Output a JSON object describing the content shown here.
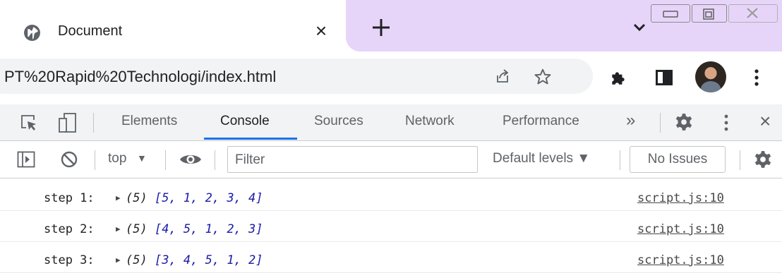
{
  "tab": {
    "title": "Document",
    "close": "×"
  },
  "address": {
    "url": "PT%20Rapid%20Technologi/index.html"
  },
  "devtools": {
    "tabs": [
      "Elements",
      "Console",
      "Sources",
      "Network",
      "Performance"
    ],
    "active_tab": "Console",
    "more": "»",
    "close": "×"
  },
  "console_toolbar": {
    "context": "top",
    "context_arrow": "▼",
    "filter_placeholder": "Filter",
    "levels": "Default levels ▼",
    "issues": "No Issues"
  },
  "logs": [
    {
      "message": "step 1:",
      "count": "(5)",
      "array": "[5, 1, 2, 3, 4]",
      "source": "script.js:10"
    },
    {
      "message": "step 2:",
      "count": "(5)",
      "array": "[4, 5, 1, 2, 3]",
      "source": "script.js:10"
    },
    {
      "message": "step 3:",
      "count": "(5)",
      "array": "[3, 4, 5, 1, 2]",
      "source": "script.js:10"
    }
  ],
  "colors": {
    "tabstrip_accent": "#e7d5f9",
    "active_tab_underline": "#1a73e8",
    "array_text": "#1a1aa6"
  }
}
